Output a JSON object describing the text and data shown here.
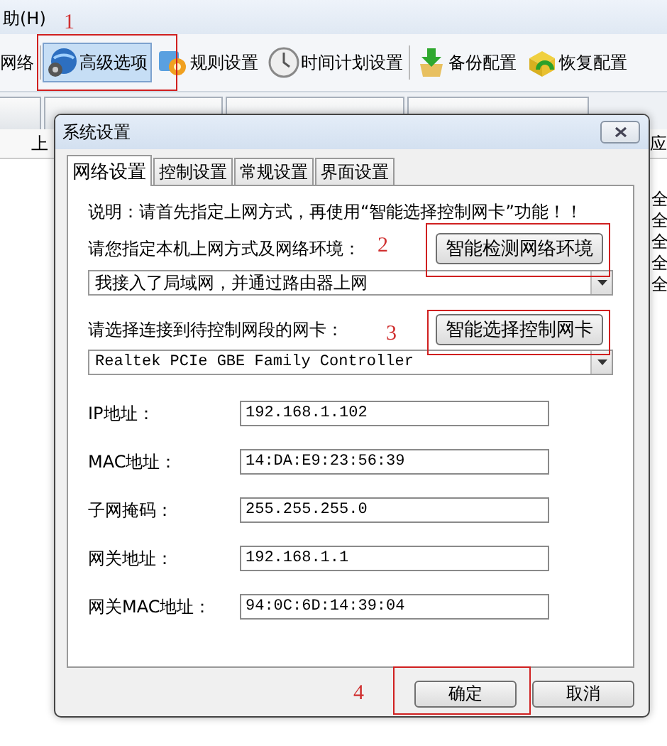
{
  "menu_bar": {
    "items": [
      "助(H)"
    ]
  },
  "toolbar": {
    "items": [
      {
        "label": "网络",
        "selected": false
      },
      {
        "label": "高级选项",
        "selected": true
      },
      {
        "label": "规则设置",
        "selected": false
      },
      {
        "label": "时间计划设置",
        "selected": false
      },
      {
        "label": "备份配置",
        "selected": false
      },
      {
        "label": "恢复配置",
        "selected": false
      }
    ]
  },
  "table": {
    "columns": [
      "上",
      "应"
    ],
    "cells": [
      "全",
      "全",
      "全",
      "全",
      "全"
    ]
  },
  "dialog": {
    "title": "系统设置",
    "tabs": [
      {
        "label": "网络设置",
        "selected": true
      },
      {
        "label": "控制设置",
        "selected": false
      },
      {
        "label": "常规设置",
        "selected": false
      },
      {
        "label": "界面设置",
        "selected": false
      }
    ],
    "note": "说明：请首先指定上网方式，再使用“智能选择控制网卡”功能！！",
    "network_label": "请您指定本机上网方式及网络环境：",
    "detect_button": "智能检测网络环境",
    "network_mode": "我接入了局域网，并通过路由器上网",
    "adapter_label": "请选择连接到待控制网段的网卡：",
    "select_button": "智能选择控制网卡",
    "adapter": "Realtek PCIe GBE Family Controller",
    "fields": [
      {
        "label": "IP地址：",
        "value": "192.168.1.102"
      },
      {
        "label": "MAC地址：",
        "value": "14:DA:E9:23:56:39"
      },
      {
        "label": "子网掩码：",
        "value": "255.255.255.0"
      },
      {
        "label": "网关地址：",
        "value": "192.168.1.1"
      },
      {
        "label": "网关MAC地址：",
        "value": "94:0C:6D:14:39:04"
      }
    ],
    "buttons": [
      "确定",
      "取消"
    ]
  },
  "annotations": [
    {
      "number": "1"
    },
    {
      "number": "2"
    },
    {
      "number": "3"
    },
    {
      "number": "4"
    }
  ]
}
